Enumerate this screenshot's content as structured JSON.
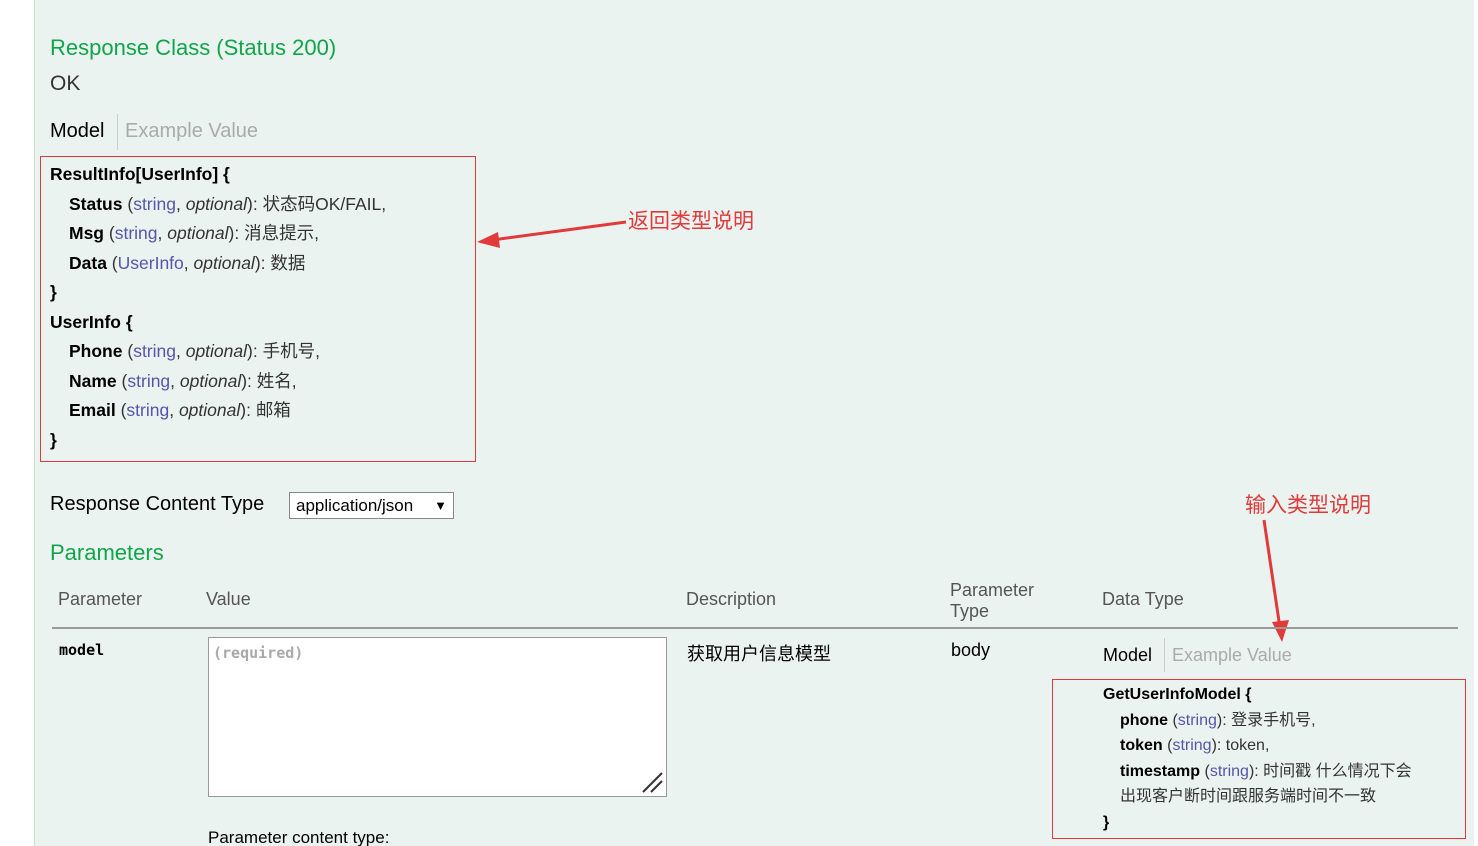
{
  "response_class": {
    "heading": "Response Class (Status 200)",
    "status_text": "OK",
    "tabs": {
      "model": "Model",
      "example": "Example Value"
    },
    "model": {
      "result_info_title": "ResultInfo[UserInfo] {",
      "result_info_fields": [
        {
          "name": "Status",
          "type": "string",
          "opt": "optional",
          "desc": "状态码OK/FAIL,"
        },
        {
          "name": "Msg",
          "type": "string",
          "opt": "optional",
          "desc": "消息提示,"
        },
        {
          "name": "Data",
          "type": "UserInfo",
          "opt": "optional",
          "desc": "数据"
        }
      ],
      "close": "}",
      "user_info_title": "UserInfo {",
      "user_info_fields": [
        {
          "name": "Phone",
          "type": "string",
          "opt": "optional",
          "desc": "手机号,"
        },
        {
          "name": "Name",
          "type": "string",
          "opt": "optional",
          "desc": "姓名,"
        },
        {
          "name": "Email",
          "type": "string",
          "opt": "optional",
          "desc": "邮箱"
        }
      ]
    }
  },
  "annotations": {
    "return_type": "返回类型说明",
    "input_type": "输入类型说明"
  },
  "response_content_type": {
    "label": "Response Content Type",
    "selected": "application/json",
    "arrow": "▼"
  },
  "parameters": {
    "heading": "Parameters",
    "columns": {
      "parameter": "Parameter",
      "value": "Value",
      "description": "Description",
      "parameter_type_1": "Parameter",
      "parameter_type_2": "Type",
      "data_type": "Data Type"
    },
    "row": {
      "name": "model",
      "placeholder": "(required)",
      "description": "获取用户信息模型",
      "param_type": "body",
      "content_type_label": "Parameter content type:",
      "tabs": {
        "model": "Model",
        "example": "Example Value"
      },
      "model_title": "GetUserInfoModel {",
      "fields": [
        {
          "name": "phone",
          "type": "string",
          "desc": "登录手机号,"
        },
        {
          "name": "token",
          "type": "string",
          "desc": "token,"
        },
        {
          "name": "timestamp",
          "type": "string",
          "desc": "时间戳 什么情况下会"
        }
      ],
      "timestamp_cont": "出现客户断时间跟服务端时间不一致",
      "close": "}"
    }
  },
  "colors": {
    "green": "#10a54a",
    "annotation_red": "#e03a3a",
    "type_blue": "#55a",
    "panel_bg": "#ebf3f0"
  }
}
